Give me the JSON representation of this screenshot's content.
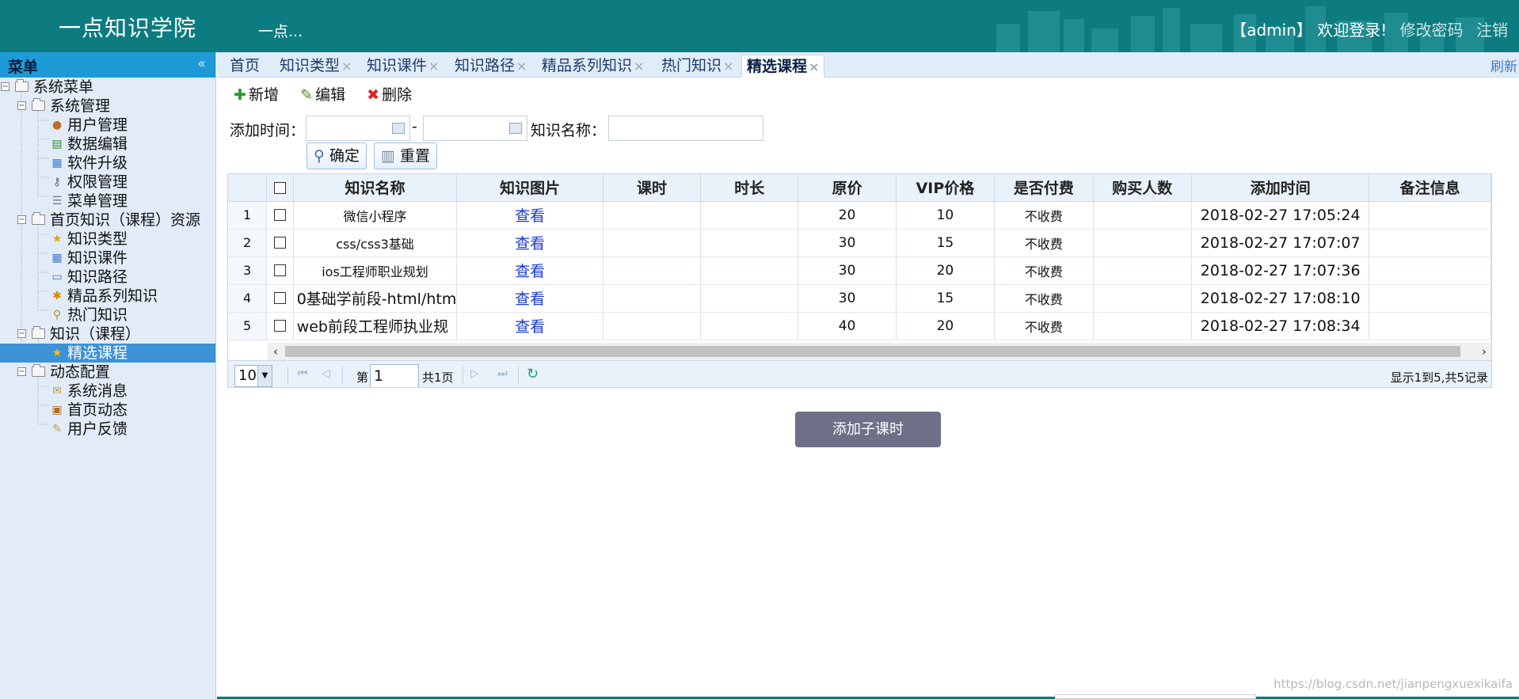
{
  "header": {
    "brand": "一点知识学院",
    "subbrand": "一点...",
    "user": "【admin】 欢迎登录!",
    "change_password": "修改密码",
    "logout": "注销"
  },
  "sidebar": {
    "title": "菜单",
    "collapse": "«",
    "nodes": [
      {
        "label": "系统菜单"
      },
      {
        "label": "系统管理"
      },
      {
        "label": "用户管理",
        "icon": "user-icon"
      },
      {
        "label": "数据编辑",
        "icon": "data-edit-icon"
      },
      {
        "label": "软件升级",
        "icon": "upgrade-icon"
      },
      {
        "label": "权限管理",
        "icon": "key-icon"
      },
      {
        "label": "菜单管理",
        "icon": "menu-list-icon"
      },
      {
        "label": "首页知识（课程）资源"
      },
      {
        "label": "知识类型",
        "icon": "star-icon"
      },
      {
        "label": "知识课件",
        "icon": "grid-icon"
      },
      {
        "label": "知识路径",
        "icon": "path-icon"
      },
      {
        "label": "精品系列知识",
        "icon": "asterisk-icon"
      },
      {
        "label": "热门知识",
        "icon": "magnifier-icon"
      },
      {
        "label": "知识（课程）"
      },
      {
        "label": "精选课程",
        "icon": "star-icon"
      },
      {
        "label": "动态配置"
      },
      {
        "label": "系统消息",
        "icon": "message-icon"
      },
      {
        "label": "首页动态",
        "icon": "clipboard-icon"
      },
      {
        "label": "用户反馈",
        "icon": "feedback-icon"
      }
    ]
  },
  "tabs": [
    "首页",
    "知识类型",
    "知识课件",
    "知识路径",
    "精品系列知识",
    "热门知识",
    "精选课程"
  ],
  "tab_close": "×",
  "refresh": "刷新",
  "toolbar": {
    "add": "新增",
    "edit": "编辑",
    "delete": "删除"
  },
  "search": {
    "time_label": "添加时间：",
    "dash": "-",
    "name_label": "知识名称：",
    "confirm": "确定",
    "reset": "重置"
  },
  "grid": {
    "columns": [
      "知识名称",
      "知识图片",
      "课时",
      "时长",
      "原价",
      "VIP价格",
      "是否付费",
      "购买人数",
      "添加时间",
      "备注信息"
    ],
    "rows": [
      {
        "n": "1",
        "name": "微信小程序",
        "img": "查看",
        "hours": "",
        "dur": "",
        "price": "20",
        "vip": "10",
        "fee": "不收费",
        "buyers": "",
        "time": "2018-02-27 17:05:24",
        "note": ""
      },
      {
        "n": "2",
        "name": "css/css3基础",
        "img": "查看",
        "hours": "",
        "dur": "",
        "price": "30",
        "vip": "15",
        "fee": "不收费",
        "buyers": "",
        "time": "2018-02-27 17:07:07",
        "note": ""
      },
      {
        "n": "3",
        "name": "ios工程师职业规划",
        "img": "查看",
        "hours": "",
        "dur": "",
        "price": "30",
        "vip": "20",
        "fee": "不收费",
        "buyers": "",
        "time": "2018-02-27 17:07:36",
        "note": ""
      },
      {
        "n": "4",
        "name": "0基础学前段-html/htm",
        "img": "查看",
        "hours": "",
        "dur": "",
        "price": "30",
        "vip": "15",
        "fee": "不收费",
        "buyers": "",
        "time": "2018-02-27 17:08:10",
        "note": ""
      },
      {
        "n": "5",
        "name": "web前段工程师执业规",
        "img": "查看",
        "hours": "",
        "dur": "",
        "price": "40",
        "vip": "20",
        "fee": "不收费",
        "buyers": "",
        "time": "2018-02-27 17:08:34",
        "note": ""
      }
    ]
  },
  "pager": {
    "page_size": "10",
    "page_prefix": "第",
    "page": "1",
    "total_pages": "共1页",
    "info": "显示1到5,共5记录"
  },
  "add_sub_button": "添加子课时",
  "watermark": "https://blog.csdn.net/jianpengxuexikaifa",
  "colors": {
    "header": "#0d7c80",
    "sidebar_header": "#1e9bd7",
    "selected": "#3d92d6",
    "add_button": "#6e7088"
  }
}
